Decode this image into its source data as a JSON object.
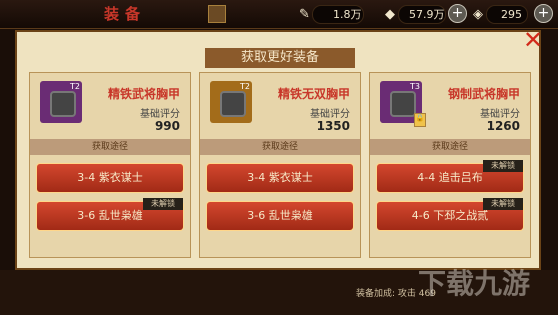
{
  "top": {
    "title": "装备",
    "stats": [
      {
        "icon": "scroll-icon",
        "value": "1.8万"
      },
      {
        "icon": "gold-icon",
        "value": "57.9万"
      },
      {
        "icon": "diamond-icon",
        "value": "295"
      }
    ]
  },
  "modal": {
    "title": "获取更好装备",
    "source_label": "获取途径",
    "cards": [
      {
        "item_name": "精铁武将胸甲",
        "tier": "T2",
        "score_label": "基础评分",
        "score": "990",
        "frame_color": "#6a2c74",
        "sources": [
          {
            "label": "3-4 紫衣谋士",
            "locked": false
          },
          {
            "label": "3-6 乱世枭雄",
            "locked": true,
            "lock_text": "未解锁"
          }
        ]
      },
      {
        "item_name": "精铁无双胸甲",
        "tier": "T2",
        "score_label": "基础评分",
        "score": "1350",
        "frame_color": "#a36c1a",
        "sources": [
          {
            "label": "3-4 紫衣谋士",
            "locked": false
          },
          {
            "label": "3-6 乱世枭雄",
            "locked": false
          }
        ]
      },
      {
        "item_name": "钢制武将胸甲",
        "tier": "T3",
        "score_label": "基础评分",
        "score": "1260",
        "frame_color": "#6a2c74",
        "sources": [
          {
            "label": "4-4 追击吕布",
            "locked": true,
            "lock_text": "未解锁"
          },
          {
            "label": "4-6 下邳之战贰",
            "locked": true,
            "lock_text": "未解锁"
          }
        ]
      }
    ]
  },
  "bottom": {
    "text": "装备加成: 攻击 469"
  },
  "watermark": "下载九游"
}
